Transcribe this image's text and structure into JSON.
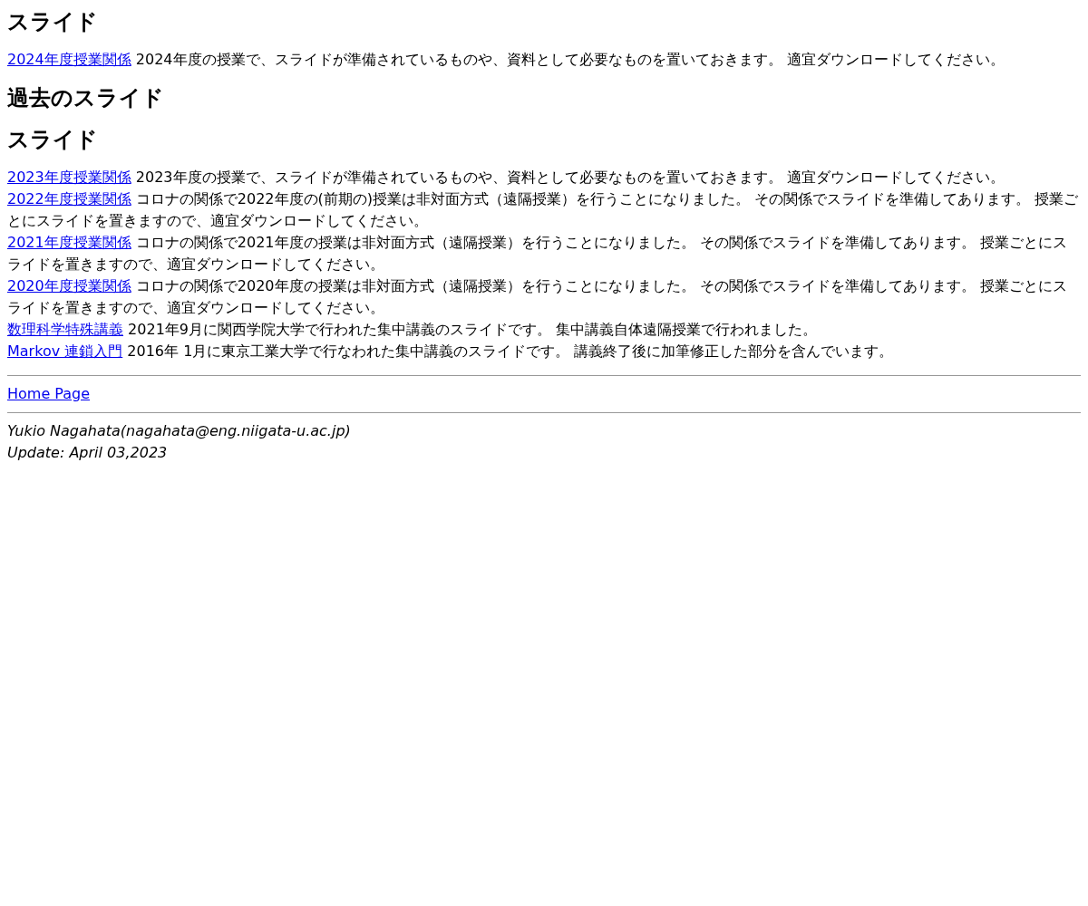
{
  "sections": [
    {
      "heading": "スライド",
      "entries": [
        {
          "link": "2024年度授業関係",
          "text": "2024年度の授業で、スライドが準備されているものや、資料として必要なものを置いておきます。 適宜ダウンロードしてください。"
        }
      ]
    },
    {
      "heading": "過去のスライド"
    },
    {
      "heading": "スライド",
      "entries": [
        {
          "link": "2023年度授業関係",
          "text": "2023年度の授業で、スライドが準備されているものや、資料として必要なものを置いておきます。 適宜ダウンロードしてください。"
        },
        {
          "link": "2022年度授業関係",
          "text": "コロナの関係で2022年度の(前期の)授業は非対面方式（遠隔授業）を行うことになりました。 その関係でスライドを準備してあります。 授業ごとにスライドを置きますので、適宜ダウンロードしてください。"
        },
        {
          "link": "2021年度授業関係",
          "text": "コロナの関係で2021年度の授業は非対面方式（遠隔授業）を行うことになりました。 その関係でスライドを準備してあります。 授業ごとにスライドを置きますので、適宜ダウンロードしてください。"
        },
        {
          "link": "2020年度授業関係",
          "text": "コロナの関係で2020年度の授業は非対面方式（遠隔授業）を行うことになりました。 その関係でスライドを準備してあります。 授業ごとにスライドを置きますので、適宜ダウンロードしてください。"
        },
        {
          "link": "数理科学特殊講義",
          "text": "2021年9月に関西学院大学で行われた集中講義のスライドです。 集中講義自体遠隔授業で行われました。"
        },
        {
          "link": "Markov 連鎖入門",
          "text": "2016年 1月に東京工業大学で行なわれた集中講義のスライドです。 講義終了後に加筆修正した部分を含んでいます。"
        }
      ]
    }
  ],
  "home_link": "Home Page",
  "footer": {
    "author": "Yukio Nagahata(nagahata@eng.niigata-u.ac.jp)",
    "updated": "Update: April 03,2023"
  }
}
